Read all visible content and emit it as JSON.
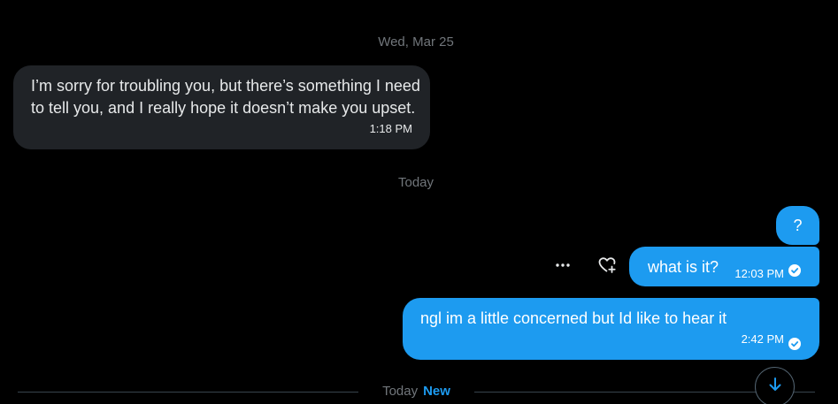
{
  "conversation": {
    "date_separator_1": "Wed, Mar 25",
    "date_separator_2": "Today",
    "messages": [
      {
        "direction": "incoming",
        "text": "I’m sorry for troubling you, but there’s something I need to tell you, and I really hope it doesn’t make you upset.",
        "time": "1:18 PM"
      },
      {
        "direction": "outgoing",
        "text": "?"
      },
      {
        "direction": "outgoing",
        "text": "what is it?",
        "time": "12:03 PM",
        "status": "seen"
      },
      {
        "direction": "outgoing",
        "text": "ngl im a little concerned but Id like to hear it",
        "time": "2:42 PM",
        "status": "seen"
      }
    ]
  },
  "message_actions": {
    "more_icon": "more-horizontal-icon",
    "react_icon": "heart-plus-icon",
    "more_glyph": "···"
  },
  "new_divider": {
    "label": "Today",
    "new_label": "New"
  },
  "scroll_button": {
    "icon": "arrow-down-icon"
  },
  "colors": {
    "background": "#000000",
    "incoming_bubble": "#202327",
    "outgoing_bubble": "#1d9bf0",
    "muted_text": "#71767b",
    "accent": "#1d9bf0"
  }
}
